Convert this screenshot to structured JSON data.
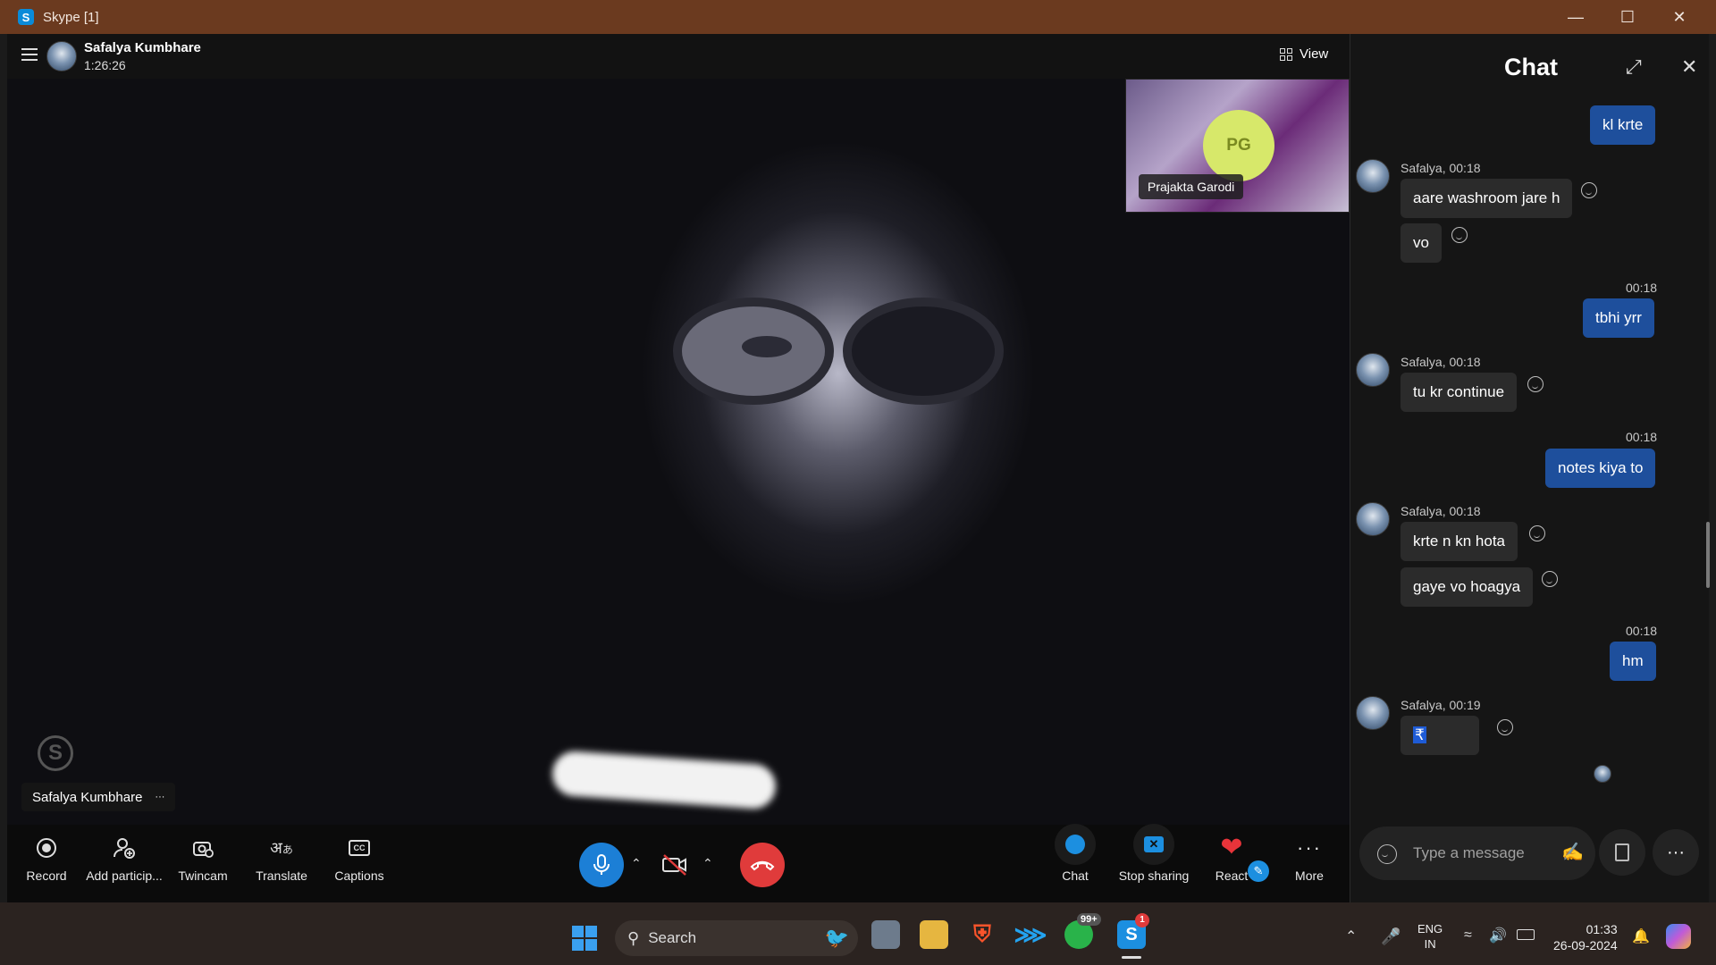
{
  "window": {
    "title": "Skype [1]"
  },
  "call": {
    "contact_name": "Safalya Kumbhare",
    "duration": "1:26:26",
    "view_label": "View",
    "self_tile_label": "Safalya Kumbhare",
    "self_tile_more": "···",
    "participant_initials": "PG",
    "participant_name": "Prajakta Garodi"
  },
  "toolbar": {
    "left": [
      {
        "label": "Record",
        "icon": "record-icon"
      },
      {
        "label": "Add particip...",
        "icon": "add-participant-icon"
      },
      {
        "label": "Twincam",
        "icon": "twincam-icon"
      },
      {
        "label": "Translate",
        "icon": "translate-icon"
      },
      {
        "label": "Captions",
        "icon": "captions-icon"
      }
    ],
    "right": [
      {
        "label": "Chat",
        "icon": "chat-icon"
      },
      {
        "label": "Stop sharing",
        "icon": "stop-sharing-icon"
      },
      {
        "label": "React",
        "icon": "heart-icon"
      },
      {
        "label": "More",
        "icon": "more-icon"
      }
    ]
  },
  "chat": {
    "title": "Chat",
    "messages": [
      {
        "sender": "me",
        "text": "kl krte"
      },
      {
        "sender": "them",
        "meta": "Safalya, 00:18",
        "text": "aare washroom jare h"
      },
      {
        "sender": "them",
        "text": "vo"
      },
      {
        "sender": "me",
        "meta": "00:18",
        "text": "tbhi yrr"
      },
      {
        "sender": "them",
        "meta": "Safalya, 00:18",
        "text": "tu kr continue"
      },
      {
        "sender": "me",
        "meta": "00:18",
        "text": "notes kiya to"
      },
      {
        "sender": "them",
        "meta": "Safalya, 00:18",
        "text": "krte n kn hota"
      },
      {
        "sender": "them",
        "text": "gaye vo hoagya"
      },
      {
        "sender": "me",
        "meta": "00:18",
        "text": "hm"
      },
      {
        "sender": "them",
        "meta": "Safalya, 00:19",
        "text": "₹"
      }
    ],
    "input_placeholder": "Type a message"
  },
  "taskbar": {
    "search_placeholder": "Search",
    "whatsapp_badge": "99+",
    "skype_badge": "1",
    "lang_1": "ENG",
    "lang_2": "IN",
    "time": "01:33",
    "date": "26-09-2024"
  },
  "colors": {
    "titlebar": "#6b3a1f",
    "mic_active": "#1c7fd6",
    "end_call": "#e03b3b",
    "my_bubble": "#1e4f9c",
    "participant_avatar": "#d7e86a"
  }
}
